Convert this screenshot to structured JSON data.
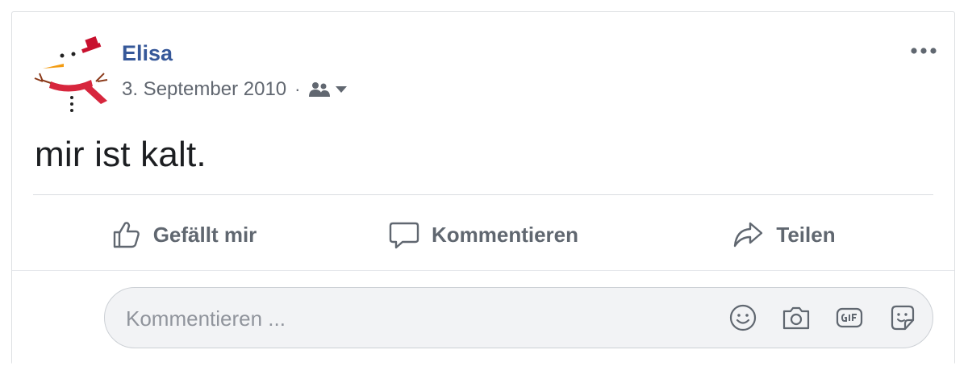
{
  "post": {
    "author": "Elisa",
    "date": "3. September 2010",
    "separator": "·",
    "text": "mir ist kalt."
  },
  "actions": {
    "like_label": "Gefällt mir",
    "comment_label": "Kommentieren",
    "share_label": "Teilen"
  },
  "comment": {
    "placeholder": "Kommentieren ..."
  },
  "colors": {
    "author": "#365899",
    "meta": "#616770",
    "action": "#606770",
    "text": "#1c1e21"
  },
  "icons": {
    "avatar": "snowman-avatar",
    "audience": "friends-icon",
    "audience_dropdown": "caret-down-icon",
    "more": "more-options-icon",
    "like": "thumbs-up-icon",
    "comment": "speech-bubble-icon",
    "share": "share-arrow-icon",
    "emoji": "smiley-icon",
    "photo": "camera-icon",
    "gif": "gif-icon",
    "sticker": "sticker-icon"
  }
}
